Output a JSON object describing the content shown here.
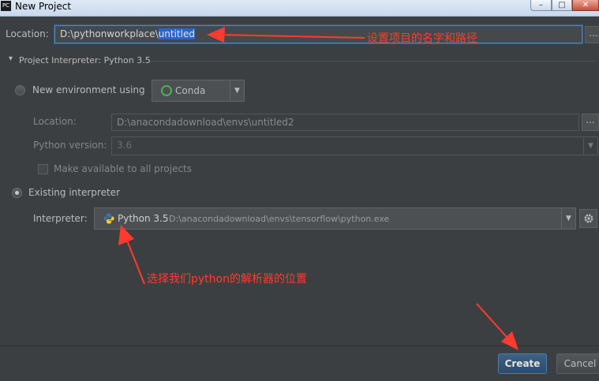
{
  "window": {
    "app_badge": "PC",
    "title": "New Project",
    "min_glyph": "–",
    "max_glyph": "□",
    "close_glyph": "✕"
  },
  "location": {
    "label": "Location:",
    "path_prefix": "D:\\pythonworkplace\\",
    "path_selected": "untitled",
    "browse": "..."
  },
  "interpreter_section": {
    "toggle": "▾",
    "title": "Project Interpreter: Python 3.5"
  },
  "new_env": {
    "label": "New environment using",
    "tool": "Conda",
    "location_label": "Location:",
    "location_value": "D:\\anacondadownload\\envs\\untitled2",
    "location_browse": "...",
    "python_version_label": "Python version:",
    "python_version_value": "3.6",
    "make_available_label": "Make available to all projects"
  },
  "existing": {
    "label": "Existing interpreter",
    "interpreter_label": "Interpreter:",
    "interpreter_name": "Python 3.5",
    "interpreter_path": "D:\\anacondadownload\\envs\\tensorflow\\python.exe",
    "dropdown_glyph": "▼"
  },
  "annotations": {
    "name_and_path": "设置项目的名字和路径",
    "interpreter_location": "选择我们python的解析器的位置"
  },
  "buttons": {
    "create": "Create",
    "cancel": "Cancel"
  },
  "colors": {
    "annotation": "#ff3a2e",
    "accent": "#4b87c4",
    "selection": "#2f65ca"
  }
}
